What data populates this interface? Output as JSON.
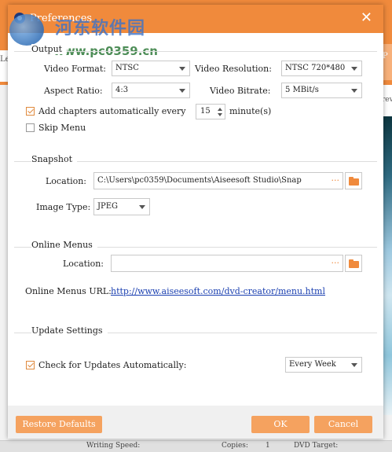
{
  "dialog": {
    "title": "Preferences",
    "close_glyph": "✕"
  },
  "watermark": {
    "name": "河东软件园",
    "url": "www.pc0359.cn"
  },
  "background": {
    "left_tab": "Le",
    "right_tab": "P",
    "right_text": "rev",
    "bottom_status": [
      "Writing Speed:",
      "Copies:",
      "1",
      "DVD Target:"
    ]
  },
  "output": {
    "section": "Output",
    "video_format_label": "Video Format:",
    "video_format_value": "NTSC",
    "video_resolution_label": "Video Resolution:",
    "video_resolution_value": "NTSC 720*480",
    "aspect_ratio_label": "Aspect Ratio:",
    "aspect_ratio_value": "4:3",
    "video_bitrate_label": "Video Bitrate:",
    "video_bitrate_value": "5 MBit/s",
    "add_chapters_label": "Add chapters automatically every",
    "add_chapters_checked": true,
    "chapter_interval": "15",
    "minute_label": "minute(s)",
    "skip_menu_label": "Skip Menu",
    "skip_menu_checked": false
  },
  "snapshot": {
    "section": "Snapshot",
    "location_label": "Location:",
    "location_value": "C:\\Users\\pc0359\\Documents\\Aiseesoft Studio\\Snap",
    "browse_dots": "···",
    "image_type_label": "Image Type:",
    "image_type_value": "JPEG"
  },
  "online_menus": {
    "section": "Online Menus",
    "location_label": "Location:",
    "location_value": "",
    "browse_dots": "···",
    "url_label": "Online Menus URL:",
    "url_value": "http://www.aiseesoft.com/dvd-creator/menu.html"
  },
  "update": {
    "section": "Update Settings",
    "check_label": "Check for Updates Automatically:",
    "check_checked": true,
    "frequency_value": "Every Week"
  },
  "footer": {
    "restore_label": "Restore Defaults",
    "ok_label": "OK",
    "cancel_label": "Cancel"
  },
  "colors": {
    "accent": "#f08a3c",
    "button": "#f5a25f",
    "link": "#1a3fb0"
  }
}
